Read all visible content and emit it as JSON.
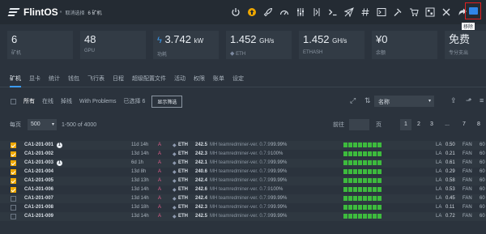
{
  "app": {
    "logo": "FlintOS",
    "logo_sub": "«",
    "crumb_back": "取消选择",
    "crumb_count": "6 矿机"
  },
  "tooltip": "移除",
  "stats": [
    {
      "value": "6",
      "unit": "",
      "label": "矿机"
    },
    {
      "value": "48",
      "unit": "",
      "label": "GPU"
    },
    {
      "value": "3.742",
      "unit": "kW",
      "label": "功耗",
      "icon": "bolt-icon"
    },
    {
      "value": "1.452",
      "unit": "GH/s",
      "label": "ETH",
      "icon": "eth-icon"
    },
    {
      "value": "1.452",
      "unit": "GH/s",
      "label": "ETHASH"
    },
    {
      "value": "¥0",
      "unit": "",
      "label": "余额"
    },
    {
      "value": "免费",
      "unit": "",
      "label": "专分支出"
    }
  ],
  "tabs": [
    "矿机",
    "显卡",
    "统计",
    "钱包",
    "飞行表",
    "日程",
    "超级配置文件",
    "活动",
    "权限",
    "账单",
    "设定"
  ],
  "filter": {
    "all": "所有",
    "online": "在线",
    "offline": "掉线",
    "problems": "With Problems",
    "selected": "已选择 6",
    "show_selected_btn": "显示筛选",
    "sort_label": "名称"
  },
  "pager": {
    "per_page_label": "每页",
    "per_page_value": "500",
    "range": "1-500 of 4000",
    "goto_label": "前往",
    "page_unit": "页",
    "pages": [
      "1",
      "2",
      "3",
      "...",
      "7",
      "8"
    ]
  },
  "rows": [
    {
      "checked": true,
      "name": "CA1-201-001",
      "badge": "1",
      "uptime": "11d 14h",
      "a": "A",
      "coin": "ETH",
      "hash": "242.5",
      "miner": "MH teamredminer-ver. 0.7.9",
      "pct": "99.99%",
      "la_label": "LA",
      "la": "0.50",
      "fan_label": "FAN",
      "fan": "60"
    },
    {
      "checked": true,
      "name": "CA1-201-002",
      "badge": "",
      "uptime": "13d 14h",
      "a": "A",
      "coin": "ETH",
      "hash": "242.3",
      "miner": "MH teamredminer-ver. 0.7.9",
      "pct": "100%",
      "la_label": "LA",
      "la": "0.21",
      "fan_label": "FAN",
      "fan": "60"
    },
    {
      "checked": true,
      "name": "CA1-201-003",
      "badge": "1",
      "uptime": "6d 1h",
      "a": "A",
      "coin": "ETH",
      "hash": "242.1",
      "miner": "MH teamredminer-ver. 0.7.9",
      "pct": "99.99%",
      "la_label": "LA",
      "la": "0.61",
      "fan_label": "FAN",
      "fan": "60"
    },
    {
      "checked": true,
      "name": "CA1-201-004",
      "badge": "",
      "uptime": "13d 8h",
      "a": "A",
      "coin": "ETH",
      "hash": "240.6",
      "miner": "MH teamredminer-ver. 0.7.9",
      "pct": "99.99%",
      "la_label": "LA",
      "la": "0.29",
      "fan_label": "FAN",
      "fan": "60"
    },
    {
      "checked": true,
      "name": "CA1-201-005",
      "badge": "",
      "uptime": "13d 13h",
      "a": "A",
      "coin": "ETH",
      "hash": "242.4",
      "miner": "MH teamredminer-ver. 0.7.9",
      "pct": "99.99%",
      "la_label": "LA",
      "la": "0.58",
      "fan_label": "FAN",
      "fan": "60"
    },
    {
      "checked": true,
      "name": "CA1-201-006",
      "badge": "",
      "uptime": "13d 14h",
      "a": "A",
      "coin": "ETH",
      "hash": "242.6",
      "miner": "MH teamredminer-ver. 0.7.9",
      "pct": "100%",
      "la_label": "LA",
      "la": "0.53",
      "fan_label": "FAN",
      "fan": "60"
    },
    {
      "checked": false,
      "name": "CA1-201-007",
      "badge": "",
      "uptime": "13d 14h",
      "a": "A",
      "coin": "ETH",
      "hash": "242.4",
      "miner": "MH teamredminer-ver. 0.7.9",
      "pct": "99.99%",
      "la_label": "LA",
      "la": "0.45",
      "fan_label": "FAN",
      "fan": "60"
    },
    {
      "checked": false,
      "name": "CA1-201-008",
      "badge": "",
      "uptime": "13d 18h",
      "a": "A",
      "coin": "ETH",
      "hash": "242.3",
      "miner": "MH teamredminer-ver. 0.7.9",
      "pct": "99.99%",
      "la_label": "LA",
      "la": "0.11",
      "fan_label": "FAN",
      "fan": "60"
    },
    {
      "checked": false,
      "name": "CA1-201-009",
      "badge": "",
      "uptime": "13d 14h",
      "a": "A",
      "coin": "ETH",
      "hash": "242.5",
      "miner": "MH teamredminer-ver. 0.7.9",
      "pct": "99.99%",
      "la_label": "LA",
      "la": "0.72",
      "fan_label": "FAN",
      "fan": "60"
    }
  ],
  "colors": {
    "accent": "#3c9bf0",
    "checked": "#f0a800",
    "health": "#3dbb3d",
    "highlight": "#e02020"
  }
}
